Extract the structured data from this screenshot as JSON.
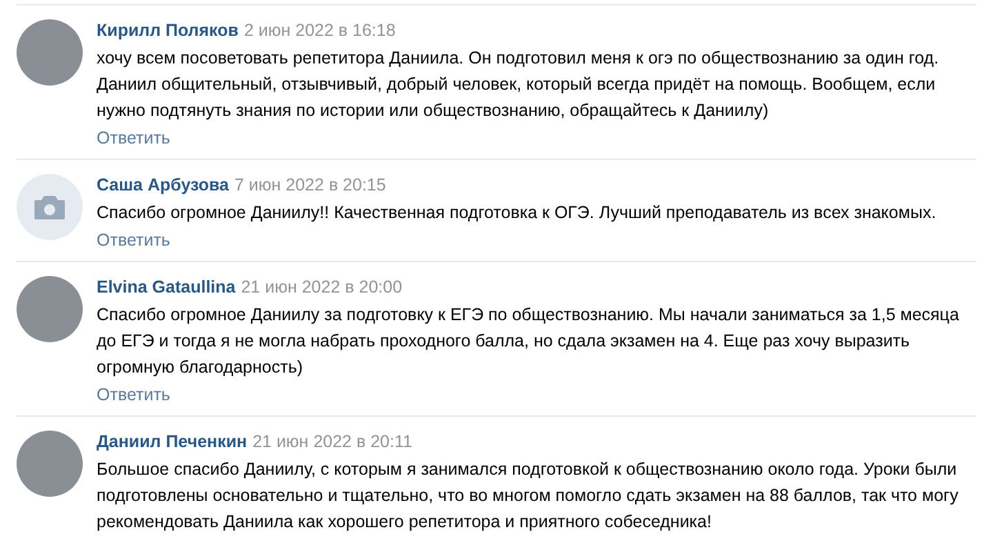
{
  "comments": [
    {
      "author": "Кирилл Поляков",
      "date": "2 июн 2022 в 16:18",
      "kind": "photo",
      "text": "хочу всем посоветовать репетитора Даниила. Он подготовил меня к огэ по обществознанию за один год. Даниил общительный, отзывчивый, добрый человек, который всегда придёт на помощь. Вообщем, если нужно подтянуть знания по истории или обществознанию, обращайтесь к Даниилу)",
      "reply": "Ответить"
    },
    {
      "author": "Саша Арбузова",
      "date": "7 июн 2022 в 20:15",
      "kind": "camera",
      "text": "Спасибо огромное Даниилу!! Качественная подготовка к ОГЭ. Лучший преподаватель из всех знакомых.",
      "reply": "Ответить"
    },
    {
      "author": "Elvina Gataullina",
      "date": "21 июн 2022 в 20:00",
      "kind": "photo",
      "text": "Спасибо огромное Даниилу за подготовку к ЕГЭ по обществознанию. Мы начали заниматься за 1,5 месяца до ЕГЭ и тогда я не могла набрать проходного балла, но сдала экзамен на 4. Еще раз хочу выразить огромную благодарность)",
      "reply": "Ответить"
    },
    {
      "author": "Даниил Печенкин",
      "date": "21 июн 2022 в 20:11",
      "kind": "photo",
      "text": "Большое спасибо Даниилу, с которым я занимался подготовкой к обществознанию около года. Уроки были подготовлены основательно и тщательно, что во многом помогло сдать экзамен на 88 баллов, так что могу рекомендовать Даниила как хорошего репетитора и приятного собеседника!"
    }
  ]
}
